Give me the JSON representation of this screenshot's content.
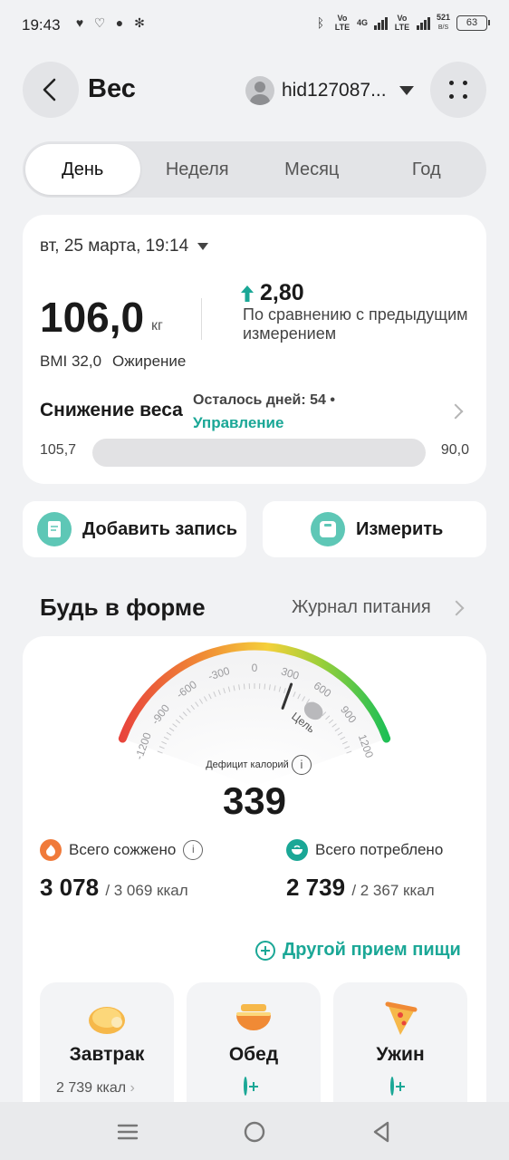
{
  "status_bar": {
    "time": "19:43",
    "network_speed": "521",
    "network_unit": "B/S",
    "battery": "63",
    "vo_lte": "Vo LTE",
    "g4": "4G"
  },
  "header": {
    "title": "Вес",
    "user_name": "hid127087..."
  },
  "tabs": [
    {
      "label": "День",
      "active": true
    },
    {
      "label": "Неделя",
      "active": false
    },
    {
      "label": "Месяц",
      "active": false
    },
    {
      "label": "Год",
      "active": false
    }
  ],
  "weight_card": {
    "date": "вт, 25 марта, 19:14",
    "weight": "106,0",
    "unit": "кг",
    "delta": "2,80",
    "delta_desc": "По сравнению с предыдущим измерением",
    "bmi": "BMI 32,0",
    "bmi_category": "Ожирение",
    "goal_title": "Снижение веса",
    "goal_remaining": "Осталось дней: 54 •",
    "goal_link": "Управление",
    "range_start": "105,7",
    "range_end": "90,0",
    "progress": 0
  },
  "actions": {
    "add_record": "Добавить запись",
    "measure": "Измерить"
  },
  "fitness": {
    "title": "Будь в форме",
    "journal_link": "Журнал питания",
    "gauge": {
      "ticks": [
        "-1200",
        "-900",
        "-600",
        "-300",
        "0",
        "300",
        "600",
        "900",
        "1200"
      ],
      "goal_label": "Цель",
      "label": "Дефицит калорий",
      "value": "339",
      "needle_value": 339
    },
    "burned": {
      "label": "Всего сожжено",
      "value": "3 078",
      "target": "/ 3 069 ккал"
    },
    "consumed": {
      "label": "Всего потреблено",
      "value": "2 739",
      "target": "/ 2 367 ккал"
    },
    "other_meal": "Другой прием пищи",
    "meals": [
      {
        "name": "Завтрак",
        "kcal": "2 739 ккал"
      },
      {
        "name": "Обед",
        "kcal": ""
      },
      {
        "name": "Ужин",
        "kcal": ""
      }
    ]
  },
  "colors": {
    "accent": "#1aa796",
    "burn": "#f07a3a",
    "gauge_red": "#e8453c",
    "gauge_yellow": "#f5c83a",
    "gauge_green": "#1fbf55"
  }
}
